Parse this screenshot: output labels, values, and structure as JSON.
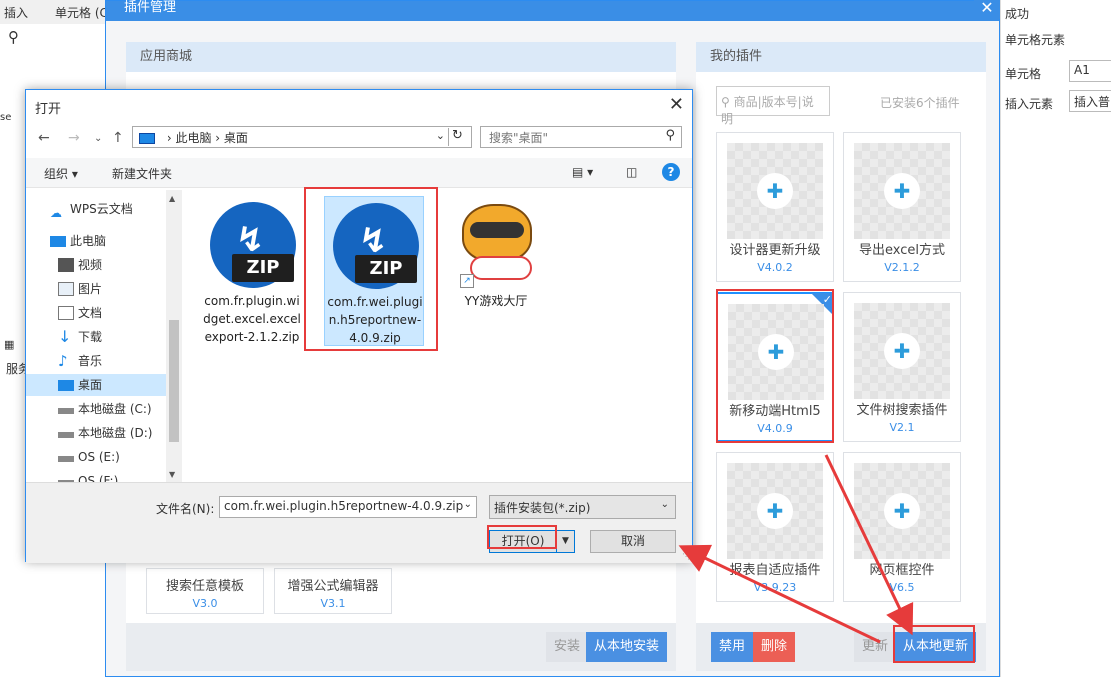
{
  "background": {
    "menu": [
      "插入",
      "单元格 (C"
    ],
    "side_labels": [
      "服务"
    ],
    "edge_text": "se"
  },
  "right_panel": {
    "status": "成功",
    "section": "单元格元素",
    "cell_label": "单元格",
    "cell_value": "A1",
    "insert_label": "插入元素",
    "insert_value": "插入普"
  },
  "plugin_manager": {
    "title": "插件管理",
    "store": {
      "header": "应用商城",
      "cards": [
        {
          "name": "搜索任意模板",
          "version": "V3.0"
        },
        {
          "name": "增强公式编辑器",
          "version": "V3.1"
        }
      ],
      "install_label": "安装",
      "local_install_label": "从本地安装"
    },
    "mine": {
      "header": "我的插件",
      "search_placeholder": "商品|版本号|说明",
      "installed_count": "已安装6个插件",
      "cards": [
        {
          "name": "设计器更新升级",
          "version": "V4.0.2"
        },
        {
          "name": "导出excel方式",
          "version": "V2.1.2"
        },
        {
          "name": "新移动端Html5",
          "version": "V4.0.9"
        },
        {
          "name": "文件树搜索插件",
          "version": "V2.1"
        },
        {
          "name": "报表自适应插件",
          "version": "V3.9.23"
        },
        {
          "name": "网页框控件",
          "version": "V6.5"
        }
      ],
      "disable_label": "禁用",
      "delete_label": "删除",
      "update_label": "更新",
      "local_update_label": "从本地更新"
    }
  },
  "file_dialog": {
    "title": "打开",
    "path": [
      "此电脑",
      "桌面"
    ],
    "search_placeholder": "搜索\"桌面\"",
    "organize_label": "组织 ▾",
    "new_folder_label": "新建文件夹",
    "tree": [
      "WPS云文档",
      "此电脑",
      "视频",
      "图片",
      "文档",
      "下载",
      "音乐",
      "桌面",
      "本地磁盘 (C:)",
      "本地磁盘 (D:)",
      "OS (E:)",
      "OS (F:)"
    ],
    "files": [
      {
        "name": "com.fr.plugin.widget.excel.excelexport-2.1.2.zip",
        "type": "zip"
      },
      {
        "name": "com.fr.wei.plugin.h5reportnew-4.0.9.zip",
        "type": "zip"
      },
      {
        "name": "YY游戏大厅",
        "type": "shortcut"
      }
    ],
    "zip_label": "ZIP",
    "filename_label": "文件名(N):",
    "filename_value": "com.fr.wei.plugin.h5reportnew-4.0.9.zip",
    "filter_value": "插件安装包(*.zip)",
    "open_label": "打开(O)",
    "cancel_label": "取消"
  },
  "colors": {
    "accent": "#3a8ee6",
    "highlight": "#e63b3b"
  }
}
